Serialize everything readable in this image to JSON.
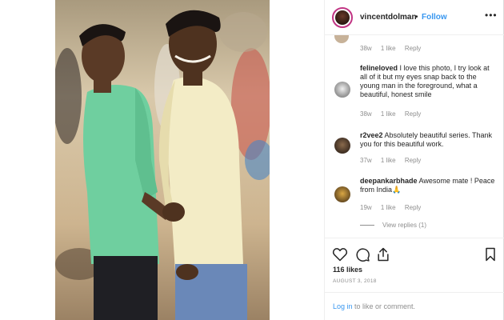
{
  "post": {
    "username": "vincentdolman",
    "separator": "•",
    "follow_label": "Follow",
    "more_label": "•••",
    "likes_text": "116 likes",
    "date_text": "AUGUST 3, 2018"
  },
  "comments": [
    {
      "username": "",
      "text": "",
      "age": "38w",
      "likes": "1 like",
      "reply_label": "Reply"
    },
    {
      "username": "felineloved",
      "text": "I love this photo, I try look at all of it but my eyes snap back to the young man in the foreground, what a beautiful, honest smile",
      "age": "38w",
      "likes": "1 like",
      "reply_label": "Reply"
    },
    {
      "username": "r2vee2",
      "text": "Absolutely beautiful series. Thank you for this beautiful work.",
      "age": "37w",
      "likes": "1 like",
      "reply_label": "Reply"
    },
    {
      "username": "deepankarbhade",
      "text": "Awesome mate ! Peace from India🙏",
      "age": "19w",
      "likes": "1 like",
      "reply_label": "Reply",
      "view_replies": "View replies (1)"
    }
  ],
  "icons": {
    "like": "heart-icon",
    "comment": "comment-icon",
    "share": "share-icon",
    "save": "bookmark-icon"
  },
  "login": {
    "link_label": "Log in",
    "rest_text": " to like or comment."
  },
  "colors": {
    "accent": "#3897f0",
    "text": "#262626",
    "muted": "#8e8e8e",
    "border": "#efefef"
  }
}
